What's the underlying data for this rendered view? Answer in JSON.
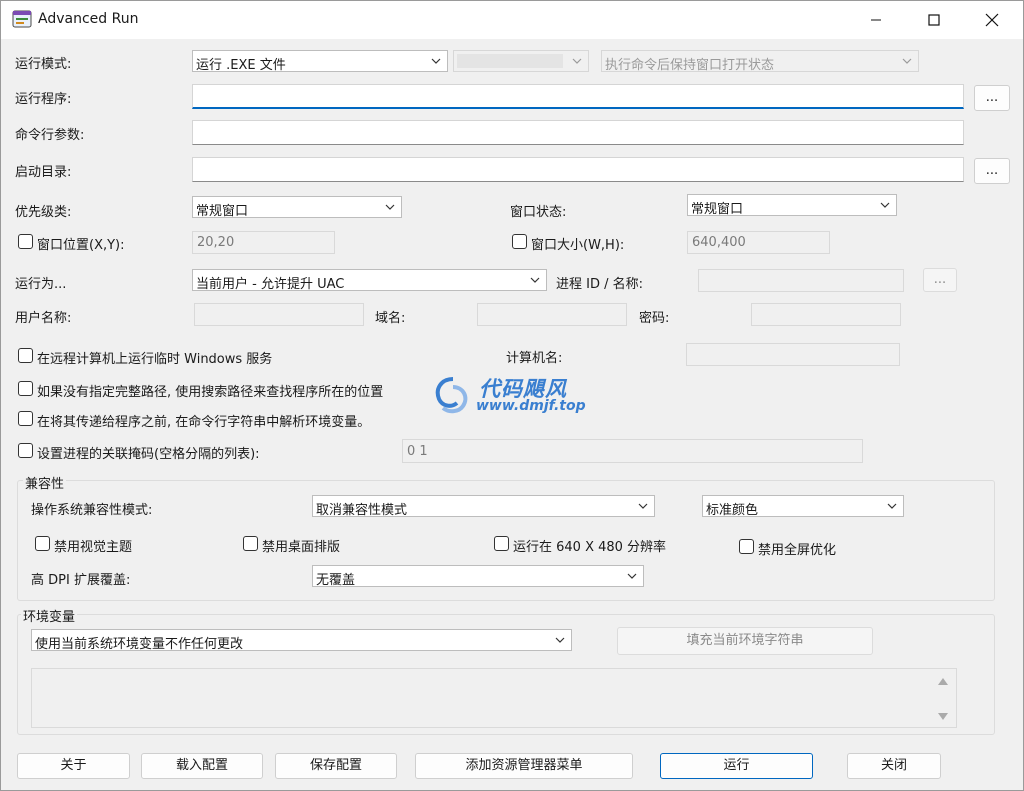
{
  "window": {
    "title": "Advanced Run"
  },
  "run_mode": {
    "label": "运行模式:",
    "value": "运行 .EXE 文件",
    "secondary_value": "",
    "keep_open_value": "执行命令后保持窗口打开状态"
  },
  "program": {
    "label": "运行程序:",
    "value": "",
    "browse_label": "..."
  },
  "args": {
    "label": "命令行参数:",
    "value": ""
  },
  "startdir": {
    "label": "启动目录:",
    "value": "",
    "browse_label": "..."
  },
  "priority": {
    "label": "优先级类:",
    "value": "常规窗口"
  },
  "window_state": {
    "label": "窗口状态:",
    "value": "常规窗口"
  },
  "window_pos": {
    "label": "窗口位置(X,Y):",
    "value": "20,20"
  },
  "window_size": {
    "label": "窗口大小(W,H):",
    "value": "640,400"
  },
  "run_as": {
    "label": "运行为...",
    "value": "当前用户 - 允许提升 UAC"
  },
  "process": {
    "label": "进程 ID / 名称:",
    "value": "",
    "browse_label": "..."
  },
  "credentials": {
    "user_label": "用户名称:",
    "domain_label": "域名:",
    "password_label": "密码:",
    "user": "",
    "domain": "",
    "password": ""
  },
  "remote": {
    "label": "在远程计算机上运行临时 Windows 服务",
    "computer_label": "计算机名:",
    "computer": ""
  },
  "options": {
    "search_path": "如果没有指定完整路径, 使用搜索路径来查找程序所在的位置",
    "expand_env": "在将其传递给程序之前, 在命令行字符串中解析环境变量。",
    "affinity_label": "设置进程的关联掩码(空格分隔的列表):",
    "affinity_value": "0 1"
  },
  "compat": {
    "group_title": "兼容性",
    "os_mode_label": "操作系统兼容性模式:",
    "os_mode_value": "取消兼容性模式",
    "color_value": "标准颜色",
    "disable_themes": "禁用视觉主题",
    "disable_desktop": "禁用桌面排版",
    "run_640": "运行在 640 X 480 分辨率",
    "disable_fullscreen": "禁用全屏优化",
    "dpi_label": "高 DPI 扩展覆盖:",
    "dpi_value": "无覆盖"
  },
  "env": {
    "group_title": "环境变量",
    "mode_value": "使用当前系统环境变量不作任何更改",
    "fill_button": "填充当前环境字符串"
  },
  "watermark": {
    "line1": "代码飓风",
    "line2": "www.dmjf.top"
  },
  "buttons": {
    "about": "关于",
    "load": "载入配置",
    "save": "保存配置",
    "explorer_menu": "添加资源管理器菜单",
    "run": "运行",
    "close": "关闭"
  },
  "colors": {
    "accent": "#0067c0",
    "watermark": "#3a7fd0"
  }
}
